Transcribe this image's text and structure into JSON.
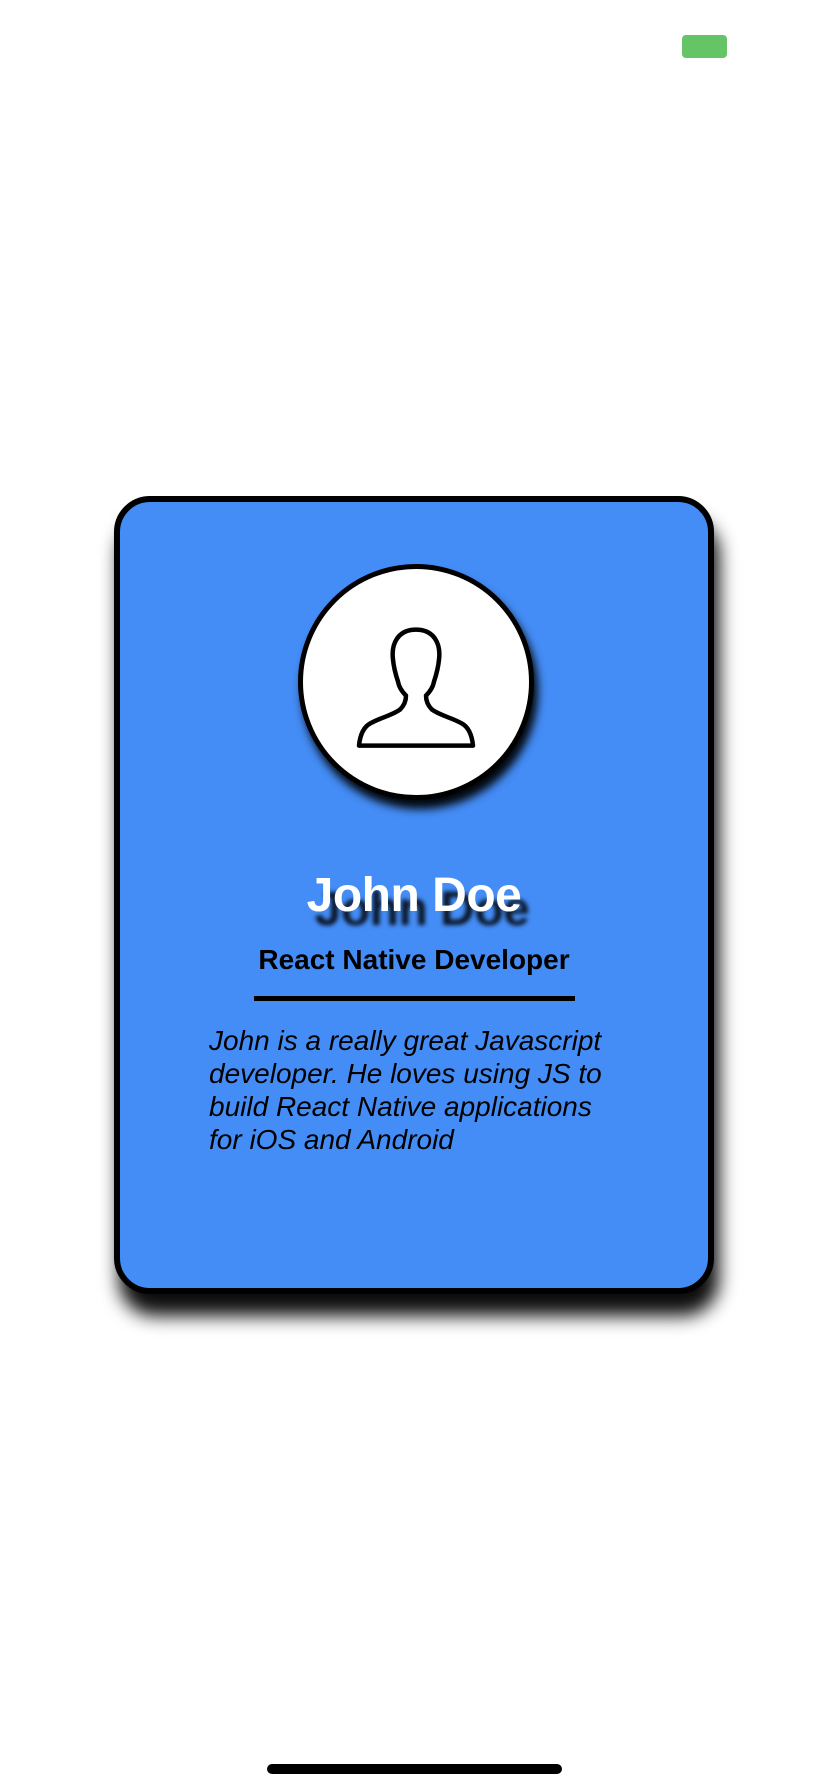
{
  "status_bar": {
    "battery_color": "#65c466"
  },
  "profile_card": {
    "background_color": "#448df6",
    "avatar_icon": "user-silhouette-icon",
    "name": "John Doe",
    "role": "React Native Developer",
    "bio": "John is a really great Javascript developer. He loves using JS to build React Native applications for iOS and Android"
  }
}
